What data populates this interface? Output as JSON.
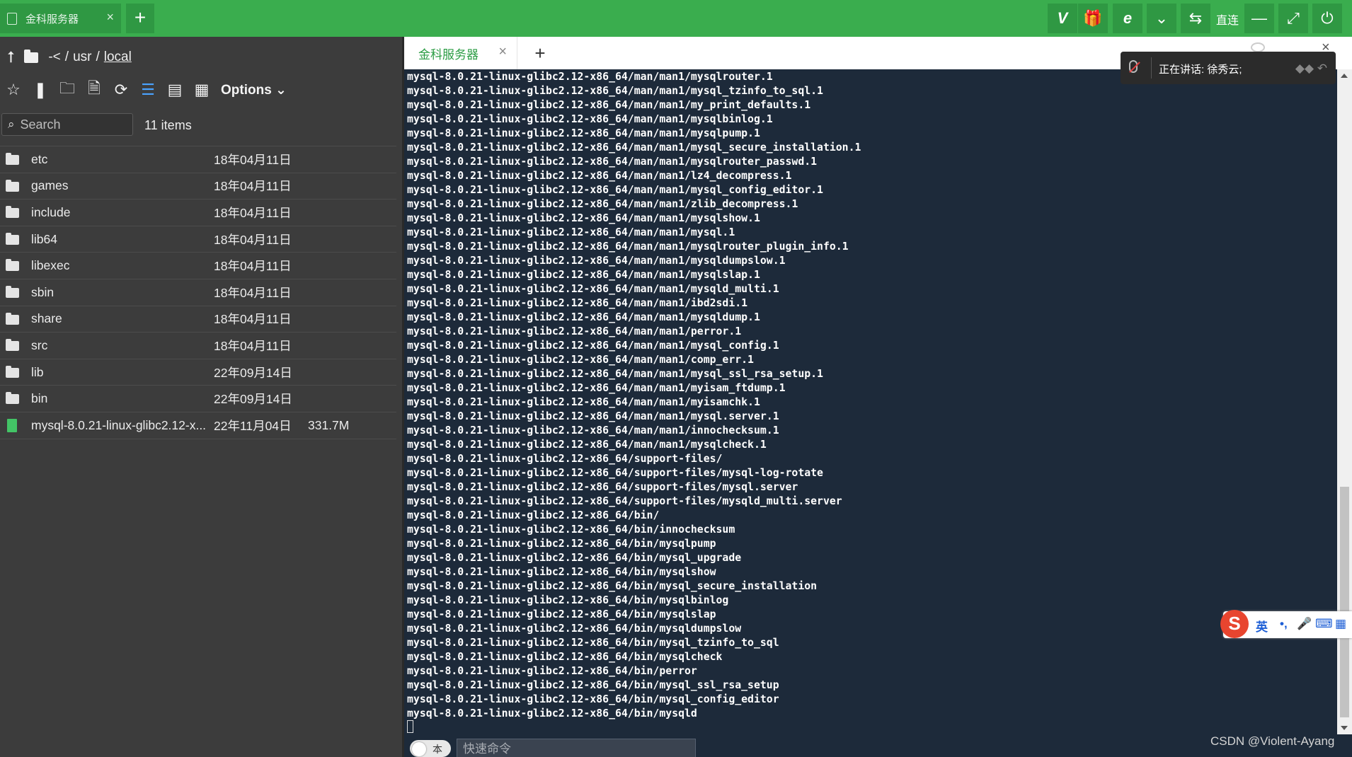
{
  "app": {
    "tab_title": "金科服务器",
    "tab_close": "×",
    "new_tab": "+",
    "toolbar": {
      "vip": "V",
      "gift": "🎁",
      "browser": "e",
      "dropdown": "⌄",
      "swap": "⇆",
      "direct_label": "直连",
      "minimize": "—",
      "fullscreen": "⤢",
      "power": "⏻"
    }
  },
  "file_panel": {
    "path": {
      "up": "⭡",
      "prefix": "-<",
      "sep1": "/",
      "dir1": "usr",
      "sep2": "/",
      "current": "local"
    },
    "tools": {
      "star": "☆",
      "bookmark": "❚",
      "new_folder": "🗀",
      "new_file": "🗎",
      "refresh": "⟳",
      "list_view": "☰",
      "detail_view": "▤",
      "grid_view": "▦",
      "options_label": "Options ⌄"
    },
    "search": {
      "placeholder": "Search",
      "icon": "⌕"
    },
    "item_count": "11 items",
    "files": [
      {
        "name": "etc",
        "date": "18年04月11日",
        "size": "",
        "type": "folder"
      },
      {
        "name": "games",
        "date": "18年04月11日",
        "size": "",
        "type": "folder"
      },
      {
        "name": "include",
        "date": "18年04月11日",
        "size": "",
        "type": "folder"
      },
      {
        "name": "lib64",
        "date": "18年04月11日",
        "size": "",
        "type": "folder"
      },
      {
        "name": "libexec",
        "date": "18年04月11日",
        "size": "",
        "type": "folder"
      },
      {
        "name": "sbin",
        "date": "18年04月11日",
        "size": "",
        "type": "folder"
      },
      {
        "name": "share",
        "date": "18年04月11日",
        "size": "",
        "type": "folder"
      },
      {
        "name": "src",
        "date": "18年04月11日",
        "size": "",
        "type": "folder"
      },
      {
        "name": "lib",
        "date": "22年09月14日",
        "size": "",
        "type": "folder"
      },
      {
        "name": "bin",
        "date": "22年09月14日",
        "size": "",
        "type": "folder"
      },
      {
        "name": "mysql-8.0.21-linux-glibc2.12-x...",
        "date": "22年11月04日",
        "size": "331.7M",
        "type": "file"
      }
    ]
  },
  "terminal": {
    "tab_title": "金科服务器",
    "tab_close": "×",
    "add_tab": "+",
    "close_hint": "×",
    "lines": [
      "mysql-8.0.21-linux-glibc2.12-x86_64/man/man1/mysqlrouter.1",
      "mysql-8.0.21-linux-glibc2.12-x86_64/man/man1/mysql_tzinfo_to_sql.1",
      "mysql-8.0.21-linux-glibc2.12-x86_64/man/man1/my_print_defaults.1",
      "mysql-8.0.21-linux-glibc2.12-x86_64/man/man1/mysqlbinlog.1",
      "mysql-8.0.21-linux-glibc2.12-x86_64/man/man1/mysqlpump.1",
      "mysql-8.0.21-linux-glibc2.12-x86_64/man/man1/mysql_secure_installation.1",
      "mysql-8.0.21-linux-glibc2.12-x86_64/man/man1/mysqlrouter_passwd.1",
      "mysql-8.0.21-linux-glibc2.12-x86_64/man/man1/lz4_decompress.1",
      "mysql-8.0.21-linux-glibc2.12-x86_64/man/man1/mysql_config_editor.1",
      "mysql-8.0.21-linux-glibc2.12-x86_64/man/man1/zlib_decompress.1",
      "mysql-8.0.21-linux-glibc2.12-x86_64/man/man1/mysqlshow.1",
      "mysql-8.0.21-linux-glibc2.12-x86_64/man/man1/mysql.1",
      "mysql-8.0.21-linux-glibc2.12-x86_64/man/man1/mysqlrouter_plugin_info.1",
      "mysql-8.0.21-linux-glibc2.12-x86_64/man/man1/mysqldumpslow.1",
      "mysql-8.0.21-linux-glibc2.12-x86_64/man/man1/mysqlslap.1",
      "mysql-8.0.21-linux-glibc2.12-x86_64/man/man1/mysqld_multi.1",
      "mysql-8.0.21-linux-glibc2.12-x86_64/man/man1/ibd2sdi.1",
      "mysql-8.0.21-linux-glibc2.12-x86_64/man/man1/mysqldump.1",
      "mysql-8.0.21-linux-glibc2.12-x86_64/man/man1/perror.1",
      "mysql-8.0.21-linux-glibc2.12-x86_64/man/man1/mysql_config.1",
      "mysql-8.0.21-linux-glibc2.12-x86_64/man/man1/comp_err.1",
      "mysql-8.0.21-linux-glibc2.12-x86_64/man/man1/mysql_ssl_rsa_setup.1",
      "mysql-8.0.21-linux-glibc2.12-x86_64/man/man1/myisam_ftdump.1",
      "mysql-8.0.21-linux-glibc2.12-x86_64/man/man1/myisamchk.1",
      "mysql-8.0.21-linux-glibc2.12-x86_64/man/man1/mysql.server.1",
      "mysql-8.0.21-linux-glibc2.12-x86_64/man/man1/innochecksum.1",
      "mysql-8.0.21-linux-glibc2.12-x86_64/man/man1/mysqlcheck.1",
      "mysql-8.0.21-linux-glibc2.12-x86_64/support-files/",
      "mysql-8.0.21-linux-glibc2.12-x86_64/support-files/mysql-log-rotate",
      "mysql-8.0.21-linux-glibc2.12-x86_64/support-files/mysql.server",
      "mysql-8.0.21-linux-glibc2.12-x86_64/support-files/mysqld_multi.server",
      "mysql-8.0.21-linux-glibc2.12-x86_64/bin/",
      "mysql-8.0.21-linux-glibc2.12-x86_64/bin/innochecksum",
      "mysql-8.0.21-linux-glibc2.12-x86_64/bin/mysqlpump",
      "mysql-8.0.21-linux-glibc2.12-x86_64/bin/mysql_upgrade",
      "mysql-8.0.21-linux-glibc2.12-x86_64/bin/mysqlshow",
      "mysql-8.0.21-linux-glibc2.12-x86_64/bin/mysql_secure_installation",
      "mysql-8.0.21-linux-glibc2.12-x86_64/bin/mysqlbinlog",
      "mysql-8.0.21-linux-glibc2.12-x86_64/bin/mysqlslap",
      "mysql-8.0.21-linux-glibc2.12-x86_64/bin/mysqldumpslow",
      "mysql-8.0.21-linux-glibc2.12-x86_64/bin/mysql_tzinfo_to_sql",
      "mysql-8.0.21-linux-glibc2.12-x86_64/bin/mysqlcheck",
      "mysql-8.0.21-linux-glibc2.12-x86_64/bin/perror",
      "mysql-8.0.21-linux-glibc2.12-x86_64/bin/mysql_ssl_rsa_setup",
      "mysql-8.0.21-linux-glibc2.12-x86_64/bin/mysql_config_editor",
      "mysql-8.0.21-linux-glibc2.12-x86_64/bin/mysqld"
    ]
  },
  "command_bar": {
    "toggle_label": "本",
    "quick_command_placeholder": "快速命令"
  },
  "speaking_popup": {
    "text": "正在讲话: 徐秀云;",
    "controls": "◆◆ ↶"
  },
  "ime": {
    "logo": "S",
    "lang": "英",
    "punct": "•,",
    "mic": "🎤",
    "keyboard": "⌨",
    "apps": "▦"
  },
  "watermark": "CSDN @Violent-Ayang",
  "colors": {
    "accent_green": "#3aad4e",
    "terminal_bg": "#1d2a3a",
    "panel_bg": "#3c3c3c",
    "file_green": "#43c466",
    "active_blue": "#4aa3ff"
  }
}
